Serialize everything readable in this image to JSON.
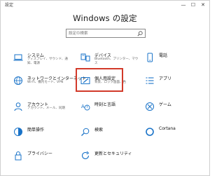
{
  "window": {
    "title": "設定",
    "minimize": "—",
    "maximize": "☐",
    "close": "✕"
  },
  "page_title": "Windows の設定",
  "search": {
    "placeholder": "設定の検索"
  },
  "accent_color": "#1a73c8",
  "highlight_color": "#d23a2a",
  "tiles": [
    {
      "label": "システム",
      "desc": "ディスプレイ、サウンド、通知、電源",
      "icon": "laptop-icon"
    },
    {
      "label": "デバイス",
      "desc": "Bluetooth、プリンター、マウス",
      "icon": "keyboard-icon"
    },
    {
      "label": "電話",
      "desc": "",
      "icon": "phone-icon"
    },
    {
      "label": "ネットワークとインターネット",
      "desc": "Wi-Fi、機内モード、VPN",
      "icon": "globe-icon"
    },
    {
      "label": "個人用設定",
      "desc": "背景、ロック画面、色",
      "icon": "personalization-icon"
    },
    {
      "label": "アプリ",
      "desc": "",
      "icon": "apps-icon"
    },
    {
      "label": "アカウント",
      "desc": "アカウント、メール、同期",
      "icon": "account-icon"
    },
    {
      "label": "時刻と言語",
      "desc": "",
      "icon": "time-language-icon"
    },
    {
      "label": "ゲーム",
      "desc": "",
      "icon": "xbox-icon"
    },
    {
      "label": "簡単操作",
      "desc": "",
      "icon": "ease-of-access-icon"
    },
    {
      "label": "検索",
      "desc": "",
      "icon": "search-icon"
    },
    {
      "label": "Cortana",
      "desc": "",
      "icon": "cortana-icon"
    },
    {
      "label": "プライバシー",
      "desc": "",
      "icon": "lock-icon"
    },
    {
      "label": "更新とセキュリティ",
      "desc": "",
      "icon": "update-icon"
    }
  ]
}
